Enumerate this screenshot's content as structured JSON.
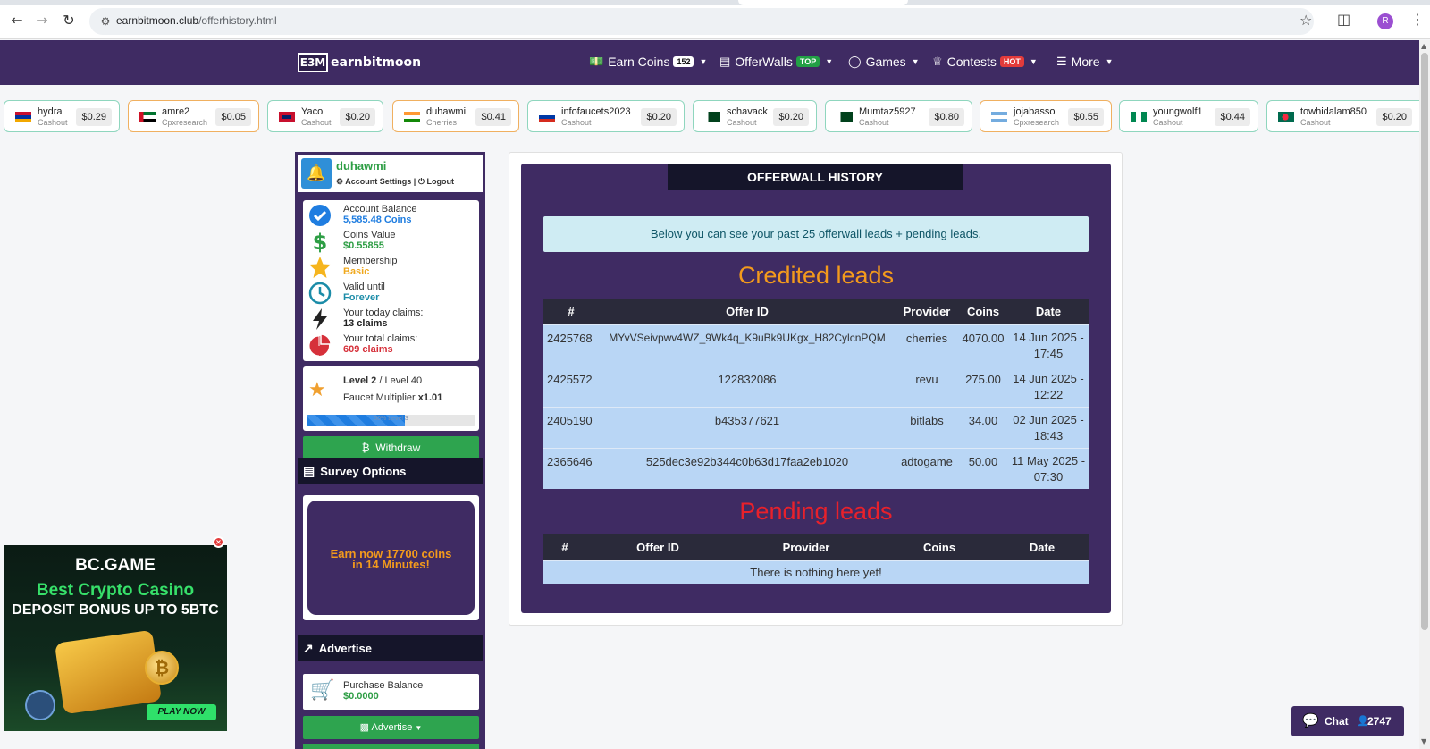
{
  "browser": {
    "url_domain": "earnbitmoon.club",
    "url_path": "/offerhistory.html",
    "profile_initial": "R",
    "icons": [
      "back-icon",
      "forward-icon",
      "reload-icon",
      "site-info-icon",
      "bookmark-star-icon",
      "extensions-icon",
      "menu-kebab-icon"
    ]
  },
  "nav": {
    "logo_mark": "E3M",
    "logo_text": "earnbitmoon",
    "items": [
      {
        "label": "Earn Coins",
        "badge": "152",
        "icon": "money-icon"
      },
      {
        "label": "OfferWalls",
        "badge": "TOP",
        "icon": "list-icon"
      },
      {
        "label": "Games",
        "badge": "",
        "icon": "gamepad-icon"
      },
      {
        "label": "Contests",
        "badge": "HOT",
        "icon": "trophy-icon"
      },
      {
        "label": "More",
        "badge": "",
        "icon": "bars-icon"
      }
    ],
    "colors": {
      "background": "#3f2b63",
      "badge_green": "#22a045",
      "badge_red": "#e33b3b"
    }
  },
  "ticker": [
    {
      "user": "hydra",
      "source": "Cashout",
      "amount": "$0.29"
    },
    {
      "user": "amre2",
      "source": "Cpxresearch",
      "amount": "$0.05"
    },
    {
      "user": "Yaco",
      "source": "Cashout",
      "amount": "$0.20"
    },
    {
      "user": "duhawmi",
      "source": "Cherries",
      "amount": "$0.41"
    },
    {
      "user": "infofaucets2023",
      "source": "Cashout",
      "amount": "$0.20"
    },
    {
      "user": "schavack",
      "source": "Cashout",
      "amount": "$0.20"
    },
    {
      "user": "Mumtaz5927",
      "source": "Cashout",
      "amount": "$0.80"
    },
    {
      "user": "jojabasso",
      "source": "Cpxresearch",
      "amount": "$0.55"
    },
    {
      "user": "youngwolf1",
      "source": "Cashout",
      "amount": "$0.44"
    },
    {
      "user": "towhidalam850",
      "source": "Cashout",
      "amount": "$0.20"
    }
  ],
  "sidebar": {
    "username": "duhawmi",
    "account_settings": "Account Settings",
    "logout": "Logout",
    "stats": [
      {
        "label": "Account Balance",
        "value": "5,585.48 Coins",
        "color": "#1f7de0"
      },
      {
        "label": "Coins Value",
        "value": "$0.55855",
        "color": "#2e9e45"
      },
      {
        "label": "Membership",
        "value": "Basic",
        "color": "#f0a81c"
      },
      {
        "label": "Valid until",
        "value": "Forever",
        "color": "#1b8ca8"
      },
      {
        "label": "Your today claims:",
        "value": "13 claims",
        "color": "#222222"
      },
      {
        "label": "Your total claims:",
        "value": "609 claims",
        "color": "#d6303a"
      }
    ],
    "level_current": "Level 2",
    "level_max": "/ Level 40",
    "multiplier_label": "Faucet Multiplier",
    "multiplier_value": "x1.01",
    "progress_text": "50% Level 3",
    "progress_fraction": 0.58,
    "withdraw": "Withdraw",
    "survey_title": "Survey Options",
    "survey_text_1": "Earn now 17700 coins",
    "survey_text_2": "in 14 Minutes!",
    "advertise_title": "Advertise",
    "purchase_label": "Purchase Balance",
    "purchase_value": "$0.0000",
    "advertise_button": "Advertise"
  },
  "main": {
    "title": "OFFERWALL HISTORY",
    "info": "Below you can see your past 25 offerwall leads + pending leads.",
    "credited_heading": "Credited leads",
    "pending_heading": "Pending leads",
    "credited_columns": [
      "#",
      "Offer ID",
      "Provider",
      "Coins",
      "Date"
    ],
    "credited_rows": [
      {
        "id": "2425768",
        "offer": "MYvVSeivpwv4WZ_9Wk4q_K9uBk9UKgx_H82CylcnPQM",
        "provider": "cherries",
        "coins": "4070.00",
        "date1": "14 Jun 2025 -",
        "date2": "17:45"
      },
      {
        "id": "2425572",
        "offer": "122832086",
        "provider": "revu",
        "coins": "275.00",
        "date1": "14 Jun 2025 -",
        "date2": "12:22"
      },
      {
        "id": "2405190",
        "offer": "b435377621",
        "provider": "bitlabs",
        "coins": "34.00",
        "date1": "02 Jun 2025 -",
        "date2": "18:43"
      },
      {
        "id": "2365646",
        "offer": "525dec3e92b344c0b63d17faa2eb1020",
        "provider": "adtogame",
        "coins": "50.00",
        "date1": "11 May 2025 -",
        "date2": "07:30"
      }
    ],
    "pending_columns": [
      "#",
      "Offer ID",
      "Provider",
      "Coins",
      "Date"
    ],
    "pending_empty": "There is nothing here yet!"
  },
  "ad": {
    "brand": "BC.GAME",
    "line1": "Best Crypto Casino",
    "line2": "DEPOSIT BONUS UP TO 5BTC",
    "cta": "PLAY NOW"
  },
  "chat": {
    "label": "Chat",
    "count": "2747"
  }
}
